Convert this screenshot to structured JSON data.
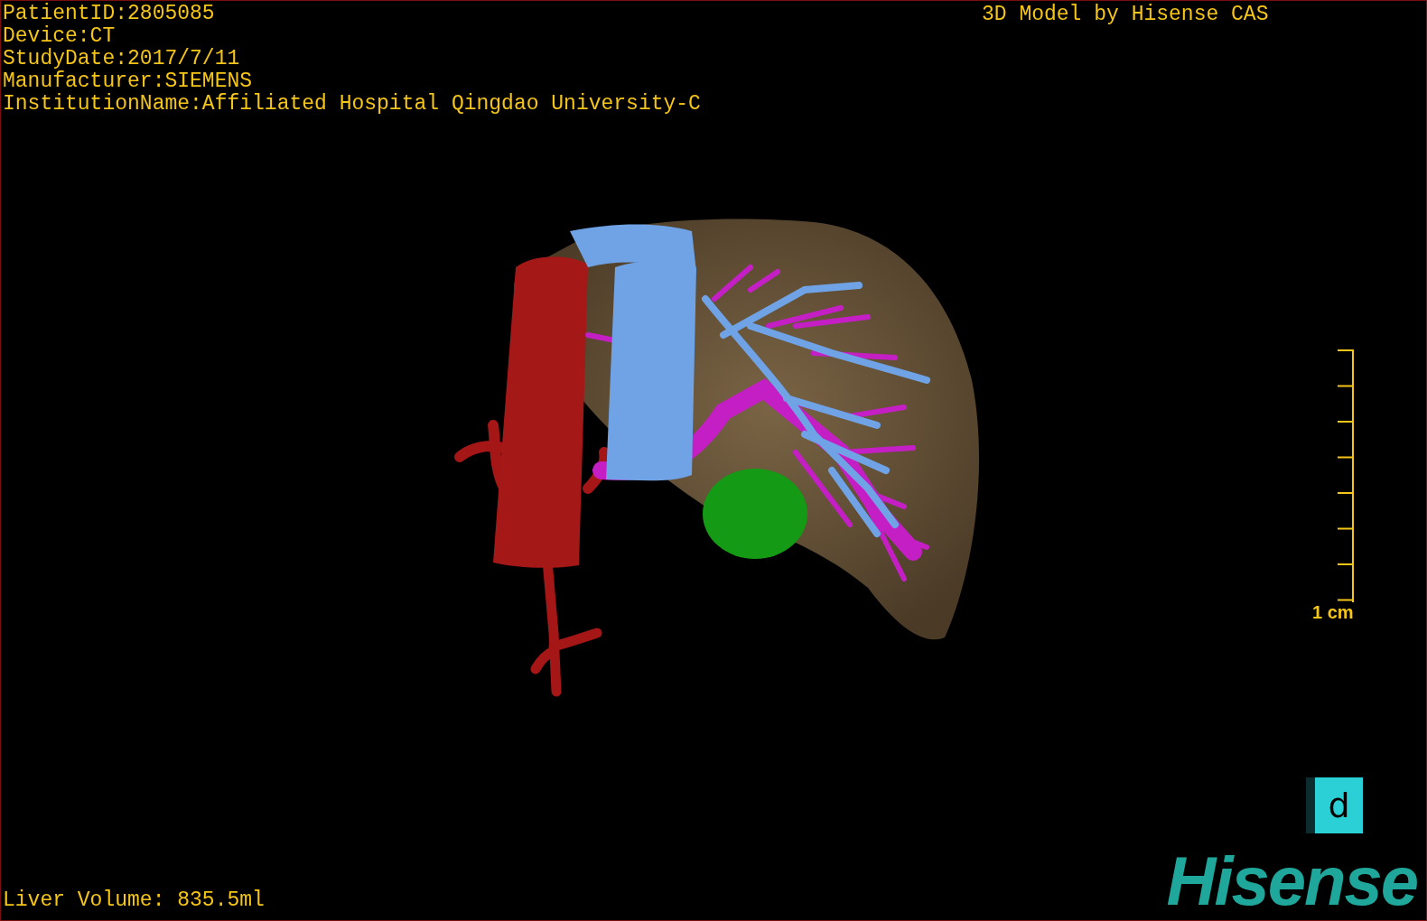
{
  "header": {
    "patient_info": [
      "PatientID:2805085",
      "Device:CT",
      "StudyDate:2017/7/11",
      "Manufacturer:SIEMENS",
      "InstitutionName:Affiliated Hospital Qingdao University-C"
    ],
    "title": "3D Model by Hisense CAS"
  },
  "scale_bar": {
    "label": "1 cm"
  },
  "orientation_marker": {
    "label": "d"
  },
  "footer": {
    "liver_volume": "Liver Volume: 835.5ml"
  },
  "logo": {
    "text": "Hisense"
  }
}
